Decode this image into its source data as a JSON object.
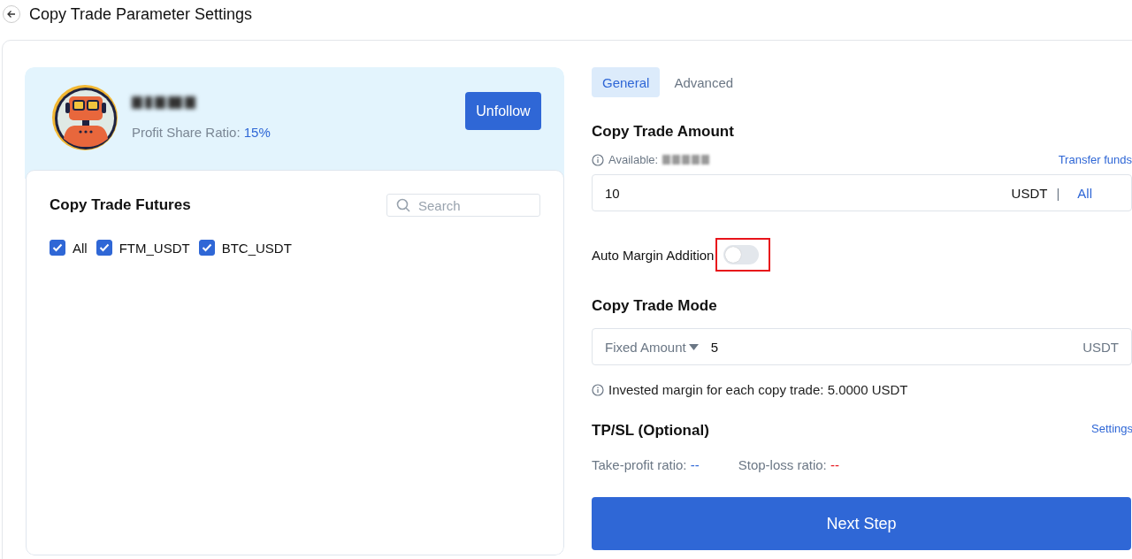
{
  "page": {
    "title": "Copy Trade Parameter Settings"
  },
  "trader": {
    "profit_share_label": "Profit Share Ratio:",
    "profit_share_value": "15%",
    "unfollow_button": "Unfollow"
  },
  "futures": {
    "title": "Copy Trade Futures",
    "search": {
      "placeholder": "Search"
    },
    "items": [
      {
        "label": "All",
        "checked": true
      },
      {
        "label": "FTM_USDT",
        "checked": true
      },
      {
        "label": "BTC_USDT",
        "checked": true
      }
    ]
  },
  "tabs": [
    {
      "label": "General",
      "selected": true
    },
    {
      "label": "Advanced",
      "selected": false
    }
  ],
  "amount": {
    "title": "Copy Trade Amount",
    "available_label": "Available:",
    "transfer_link": "Transfer funds",
    "value": "10",
    "unit": "USDT",
    "separator": "|",
    "all_link": "All"
  },
  "auto_margin": {
    "label": "Auto Margin Addition",
    "on": false,
    "highlighted": true
  },
  "mode": {
    "title": "Copy Trade Mode",
    "mode_select": "Fixed Amount",
    "value": "5",
    "unit": "USDT",
    "note": "Invested margin for each copy trade: 5.0000 USDT"
  },
  "tpsl": {
    "title": "TP/SL (Optional)",
    "settings_link": "Settings",
    "take_profit_label": "Take-profit ratio:",
    "take_profit_value": "--",
    "stop_loss_label": "Stop-loss ratio:",
    "stop_loss_value": "--"
  },
  "next_button": "Next Step"
}
